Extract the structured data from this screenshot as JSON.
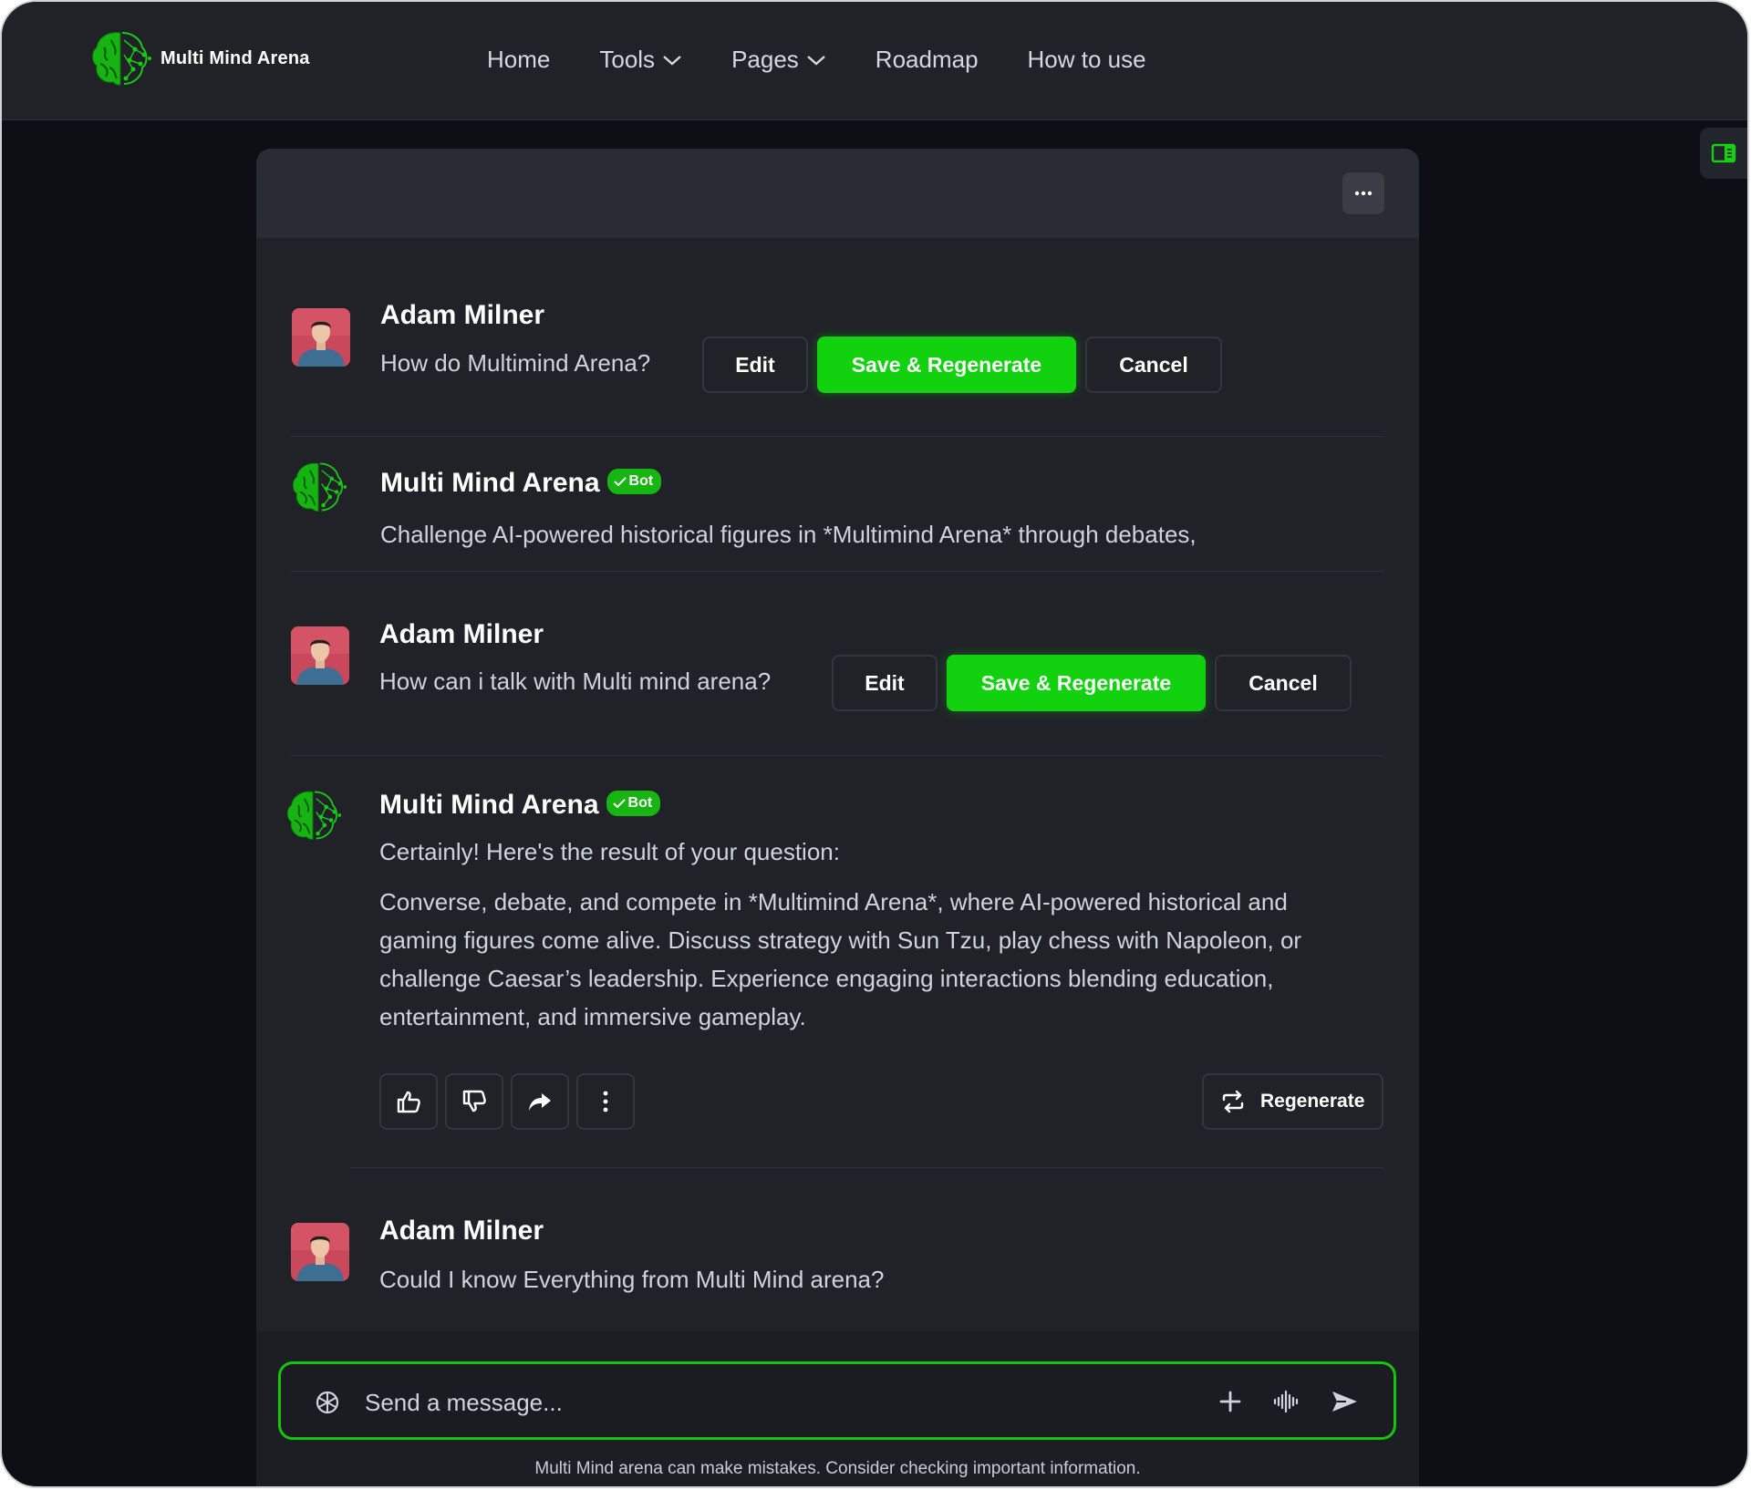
{
  "app": {
    "brand_name": "Multi Mind Arena"
  },
  "nav": {
    "items": [
      {
        "label": "Home"
      },
      {
        "label": "Tools"
      },
      {
        "label": "Pages"
      },
      {
        "label": "Roadmap"
      },
      {
        "label": "How to use"
      }
    ]
  },
  "chat": {
    "bot_badge": "Bot",
    "messages": [
      {
        "author": "Adam Milner",
        "text": "How do Multimind Arena?",
        "actions": {
          "edit": "Edit",
          "save": "Save & Regenerate",
          "cancel": "Cancel"
        }
      },
      {
        "author": "Multi Mind Arena",
        "text": "Challenge AI-powered historical figures in *Multimind Arena* through debates,"
      },
      {
        "author": "Adam Milner",
        "text": "How can i talk with Multi mind arena?",
        "actions": {
          "edit": "Edit",
          "save": "Save & Regenerate",
          "cancel": "Cancel"
        }
      },
      {
        "author": "Multi Mind Arena",
        "intro": "Certainly! Here's the result of your question:",
        "body": "Converse, debate, and compete in *Multimind Arena*, where AI-powered historical and gaming figures come alive. Discuss strategy with Sun Tzu, play chess with Napoleon, or challenge Caesar’s leadership. Experience engaging interactions blending education, entertainment, and immersive gameplay.",
        "regenerate_label": "Regenerate"
      },
      {
        "author": "Adam Milner",
        "text": "Could I know Everything from Multi Mind arena?"
      }
    ]
  },
  "composer": {
    "placeholder": "Send a message..."
  },
  "footer": {
    "note": "Multi Mind arena can make mistakes. Consider checking important information."
  },
  "colors": {
    "accent": "#12d10e",
    "background": "#0e0f14",
    "panel": "#202228",
    "header": "#2a2c33"
  },
  "icons": [
    "brain-logo-icon",
    "chevron-down-icon",
    "sidebar-toggle-icon",
    "more-horizontal-icon",
    "check-icon",
    "thumbs-up-icon",
    "thumbs-down-icon",
    "share-icon",
    "more-vertical-icon",
    "regenerate-icon",
    "ai-spark-icon",
    "plus-icon",
    "voice-wave-icon",
    "send-icon"
  ]
}
